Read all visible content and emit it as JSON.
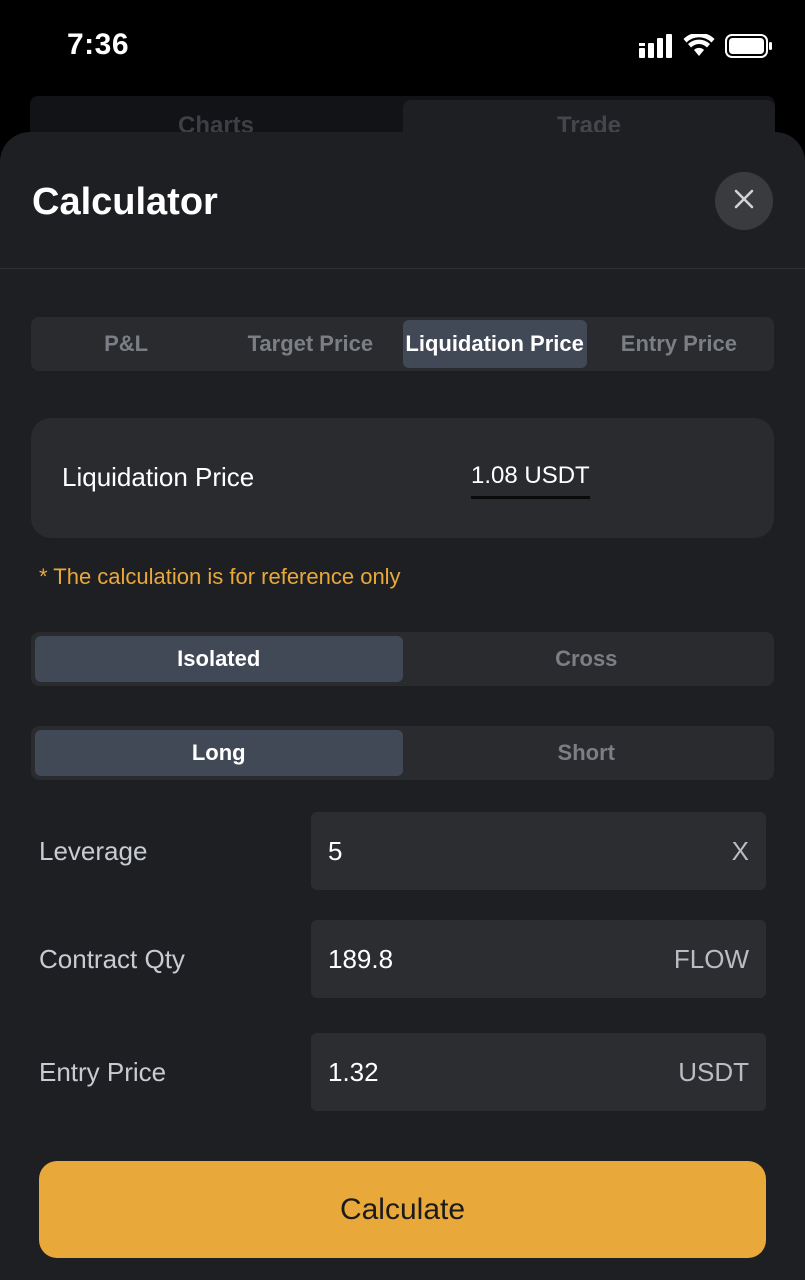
{
  "status_bar": {
    "time": "7:36",
    "icons": [
      "cellular-signal-icon",
      "wifi-icon",
      "battery-icon"
    ]
  },
  "background_page": {
    "tabs": [
      "Charts",
      "Trade"
    ]
  },
  "calculator": {
    "title": "Calculator",
    "close_icon": "close-icon",
    "tabs": [
      "P&L",
      "Target Price",
      "Liquidation Price",
      "Entry Price"
    ],
    "active_tab": "Liquidation Price",
    "result": {
      "label": "Liquidation Price",
      "value": "1.08 USDT"
    },
    "note": "* The calculation is for reference only",
    "margin_mode": {
      "options": [
        "Isolated",
        "Cross"
      ],
      "selected": "Isolated"
    },
    "position_side": {
      "options": [
        "Long",
        "Short"
      ],
      "selected": "Long"
    },
    "fields": {
      "leverage": {
        "label": "Leverage",
        "value": "5",
        "unit": "X"
      },
      "contract_qty": {
        "label": "Contract Qty",
        "value": "189.8",
        "unit": "FLOW"
      },
      "entry_price": {
        "label": "Entry Price",
        "value": "1.32",
        "unit": "USDT"
      }
    },
    "calculate_label": "Calculate"
  },
  "colors": {
    "accent": "#e8a83a",
    "sheet_bg": "#1e1f22",
    "active_segment": "#414957"
  }
}
